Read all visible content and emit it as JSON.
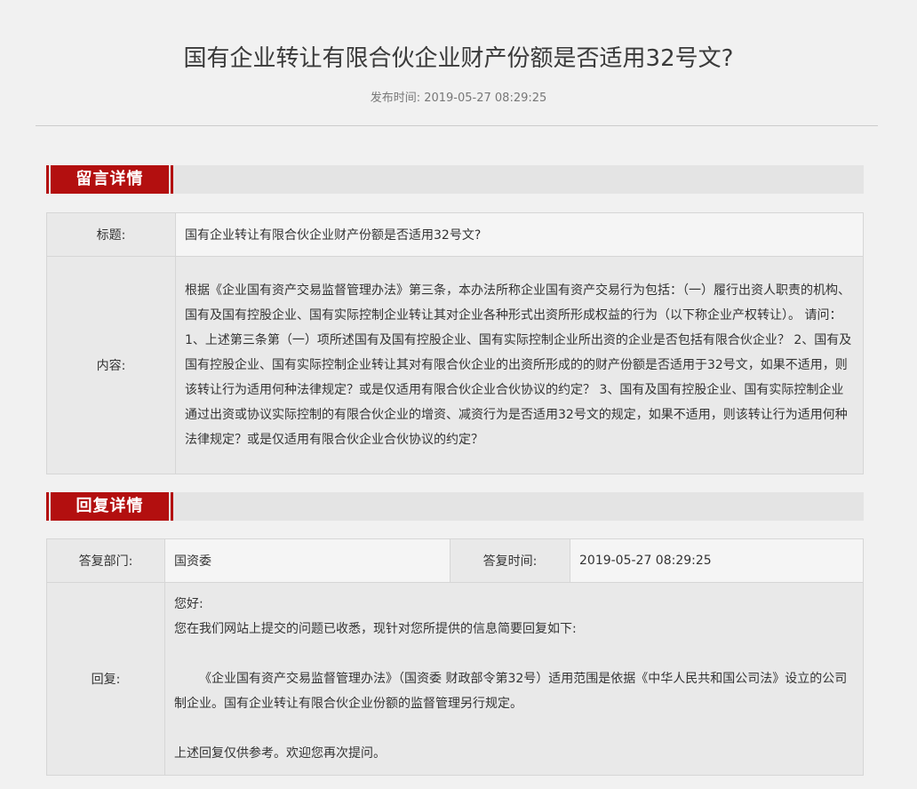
{
  "page": {
    "title": "国有企业转让有限合伙企业财产份额是否适用32号文?",
    "publish_label": "发布时间:",
    "publish_time": "2019-05-27 08:29:25"
  },
  "message_section": {
    "heading": "留言详情",
    "title_label": "标题:",
    "title_value": "国有企业转让有限合伙企业财产份额是否适用32号文?",
    "content_label": "内容:",
    "content_value": "根据《企业国有资产交易监督管理办法》第三条，本办法所称企业国有资产交易行为包括：（一）履行出资人职责的机构、国有及国有控股企业、国有实际控制企业转让其对企业各种形式出资所形成权益的行为（以下称企业产权转让）。 请问： 1、上述第三条第（一）项所述国有及国有控股企业、国有实际控制企业所出资的企业是否包括有限合伙企业？ 2、国有及国有控股企业、国有实际控制企业转让其对有限合伙企业的出资所形成的的财产份额是否适用于32号文，如果不适用，则该转让行为适用何种法律规定？或是仅适用有限合伙企业合伙协议的约定？ 3、国有及国有控股企业、国有实际控制企业通过出资或协议实际控制的有限合伙企业的增资、减资行为是否适用32号文的规定，如果不适用，则该转让行为适用何种法律规定？或是仅适用有限合伙企业合伙协议的约定？"
  },
  "reply_section": {
    "heading": "回复详情",
    "dept_label": "答复部门:",
    "dept_value": "国资委",
    "time_label": "答复时间:",
    "time_value": "2019-05-27 08:29:25",
    "reply_label": "回复:",
    "reply_greeting": "您好:",
    "reply_intro": "您在我们网站上提交的问题已收悉，现针对您所提供的信息简要回复如下:",
    "reply_body": "《企业国有资产交易监督管理办法》（国资委 财政部令第32号）适用范围是依据《中华人民共和国公司法》设立的公司制企业。国有企业转让有限合伙企业份额的监督管理另行规定。",
    "reply_closing": "上述回复仅供参考。欢迎您再次提问。"
  },
  "colors": {
    "accent": "#b30f0f",
    "background": "#f1f1f1",
    "bar": "#e4e4e4"
  }
}
